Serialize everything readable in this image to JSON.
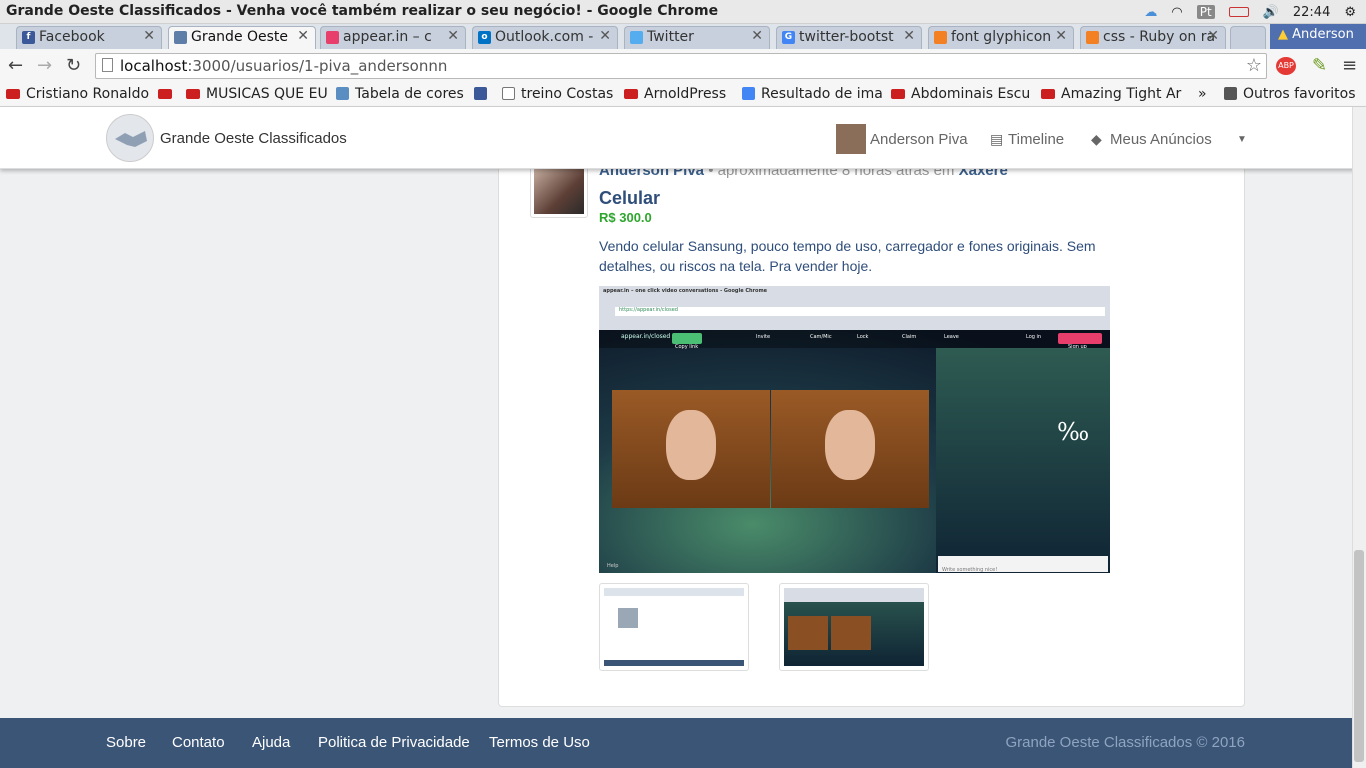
{
  "os": {
    "window_title": "Grande Oeste Classificados - Venha você também realizar o seu negócio! - Google Chrome",
    "lang_badge": "Pt",
    "clock": "22:44"
  },
  "tabs": [
    {
      "label": "Facebook",
      "color": "#3b5998",
      "icon": "facebook-icon"
    },
    {
      "label": "Grande Oeste",
      "color": "#5e7ea8",
      "icon": "handshake-icon"
    },
    {
      "label": "appear.in – c",
      "color": "#e83e6c",
      "icon": "appear-icon"
    },
    {
      "label": "Outlook.com -",
      "color": "#0072c6",
      "icon": "outlook-icon"
    },
    {
      "label": "Twitter",
      "color": "#55acee",
      "icon": "twitter-icon"
    },
    {
      "label": "twitter-bootst",
      "color": "#4285f4",
      "icon": "google-icon"
    },
    {
      "label": "font glyphicon",
      "color": "#f48024",
      "icon": "stackoverflow-icon"
    },
    {
      "label": "css - Ruby on ra",
      "color": "#f48024",
      "icon": "stackoverflow-icon"
    }
  ],
  "profile_name": "Anderson",
  "address": {
    "host": "localhost",
    "path": ":3000/usuarios/1-piva_andersonnn"
  },
  "bookmarks": [
    {
      "label": "Cristiano Ronaldo",
      "icon": "youtube-icon"
    },
    {
      "label": "",
      "icon": "youtube-icon"
    },
    {
      "label": "MUSICAS QUE EU",
      "icon": "youtube-icon"
    },
    {
      "label": "Tabela de cores",
      "icon": "image-icon"
    },
    {
      "label": "",
      "icon": "facebook-icon"
    },
    {
      "label": "treino Costas",
      "icon": "page-icon"
    },
    {
      "label": "ArnoldPress",
      "icon": "youtube-icon"
    },
    {
      "label": "Resultado de ima",
      "icon": "google-icon"
    },
    {
      "label": "Abdominais Escu",
      "icon": "youtube-icon"
    },
    {
      "label": "Amazing Tight Ar",
      "icon": "youtube-icon"
    }
  ],
  "bookmarks_more": "»",
  "bookmarks_other": "Outros favoritos",
  "navbar": {
    "brand": "Grande Oeste Classificados",
    "user": "Anderson Piva",
    "timeline": "Timeline",
    "ads": "Meus Anúncios"
  },
  "post": {
    "author": "Anderson Piva",
    "meta": "•  aproximadamente 8 horas atrás em",
    "location": "Xaxerê",
    "title": "Celular",
    "price": "R$ 300.0",
    "description": "Vendo celular Sansung, pouco tempo de uso, carregador e fones originais. Sem detalhes, ou riscos na tela. Pra vender hoje."
  },
  "screenshot_text": {
    "window_title": "appear.in – one click video conversations - Google Chrome",
    "url": "https://appear.in/closed",
    "room": "appear.in/closed",
    "copy": "Copy link",
    "invite": "Invite",
    "cam": "Cam/Mic",
    "lock": "Lock",
    "claim": "Claim",
    "leave": "Leave",
    "login": "Log in",
    "signup": "Sign up",
    "write": "Write something nice!",
    "help": "Help",
    "permille": "‰"
  },
  "footer": {
    "links": [
      "Sobre",
      "Contato",
      "Ajuda",
      "Politica de Privacidade",
      "Termos de Uso"
    ],
    "copyright": "Grande Oeste Classificados © 2016"
  }
}
